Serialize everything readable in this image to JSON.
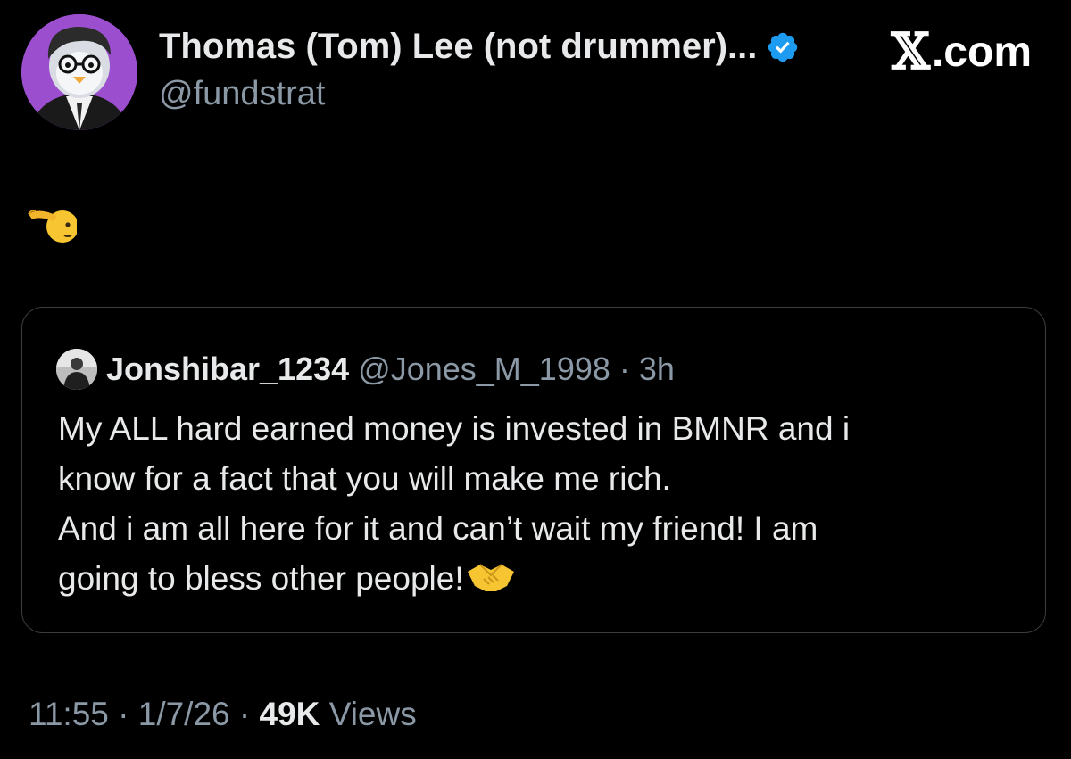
{
  "tweet": {
    "author": {
      "display_name": "Thomas (Tom) Lee (not drummer)...",
      "handle": "@fundstrat",
      "verified": true,
      "avatar": "penguin-avatar-with-glasses",
      "avatar_bg": "#9b4fcf"
    },
    "brand": {
      "x": "𝕏",
      "suffix": ".com"
    },
    "content_icon": "saluting-face-emoji",
    "quoted": {
      "display_name": "Jonshibar_1234",
      "handle": "@Jones_M_1998",
      "separator": "·",
      "time_ago": "3h",
      "lines": [
        "My ALL hard earned money is invested in BMNR and i",
        "know for a fact that you will make me rich.",
        "And i am all here for it and can’t wait my friend! I am",
        "going to bless other people!"
      ],
      "trailing_icon": "handshake-emoji"
    },
    "footer": {
      "time": "11:55",
      "sep": "·",
      "date": "1/7/26",
      "views_count": "49K",
      "views_label": "Views"
    }
  },
  "colors": {
    "background": "#000000",
    "text_primary": "#e7e9ea",
    "text_secondary": "#8b98a5",
    "verified_badge": "#1d9bf0",
    "card_border": "#3a3e42"
  }
}
